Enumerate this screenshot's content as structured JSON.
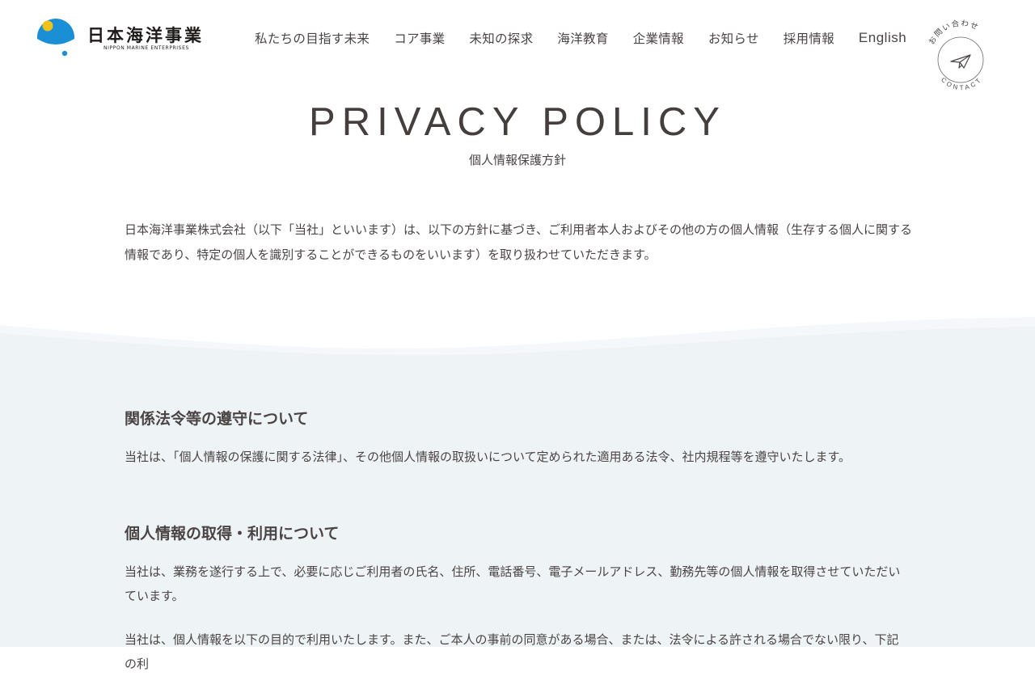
{
  "brand": {
    "name": "日本海洋事業",
    "sub": "NIPPON MARINE ENTERPRISES",
    "colors": {
      "sea": "#1a8fd6",
      "sun": "#f2c21b",
      "text": "#1f1b1b"
    }
  },
  "nav": {
    "items": [
      {
        "label": "私たちの目指す未来"
      },
      {
        "label": "コア事業"
      },
      {
        "label": "未知の探求"
      },
      {
        "label": "海洋教育"
      },
      {
        "label": "企業情報"
      },
      {
        "label": "お知らせ"
      },
      {
        "label": "採用情報"
      },
      {
        "label": "English"
      }
    ],
    "contact": {
      "top": "お問い合わせ",
      "bottom": "CONTACT",
      "icon": "paper-plane-icon"
    }
  },
  "page": {
    "title": "PRIVACY POLICY",
    "subtitle": "個人情報保護方針",
    "intro": "日本海洋事業株式会社（以下「当社」といいます）は、以下の方針に基づき、ご利用者本人およびその他の方の個人情報（生存する個人に関する情報であり、特定の個人を識別することができるものをいいます）を取り扱わせていただきます。"
  },
  "sections": [
    {
      "heading": "関係法令等の遵守について",
      "paragraphs": [
        "当社は、「個人情報の保護に関する法律」、その他個人情報の取扱いについて定められた適用ある法令、社内規程等を遵守いたします。"
      ]
    },
    {
      "heading": "個人情報の取得・利用について",
      "paragraphs": [
        "当社は、業務を遂行する上で、必要に応じご利用者の氏名、住所、電話番号、電子メールアドレス、勤務先等の個人情報を取得させていただいています。",
        "当社は、個人情報を以下の目的で利用いたします。また、ご本人の事前の同意がある場合、または、法令による許される場合でない限り、下記の利"
      ]
    }
  ],
  "colors": {
    "band": "#eef3f6",
    "text": "#4a4544"
  }
}
